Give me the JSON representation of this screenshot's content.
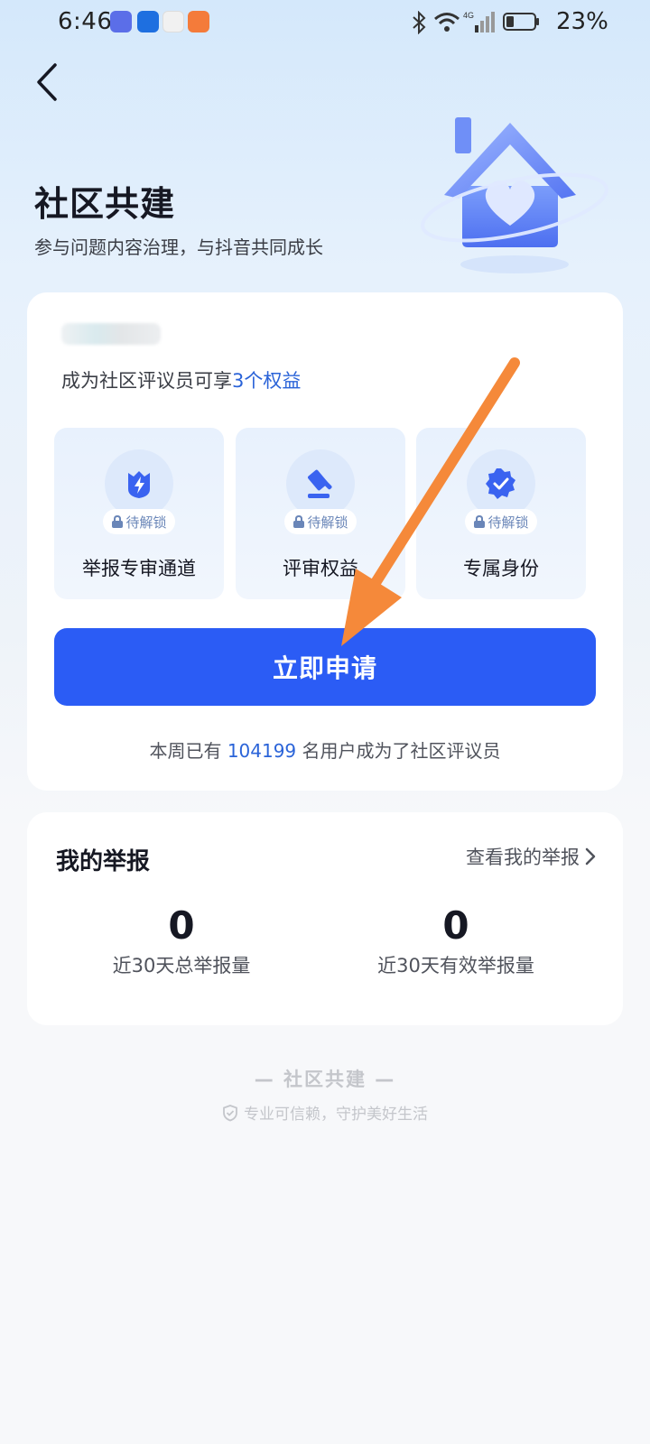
{
  "status_bar": {
    "time": "6:46",
    "battery": "23%"
  },
  "header": {
    "back_icon": "back-arrow-icon"
  },
  "page": {
    "title": "社区共建",
    "subtitle": "参与问题内容治理，与抖音共同成长"
  },
  "benefits_card": {
    "intro_prefix": "成为社区评议员可享",
    "intro_highlight": "3个权益",
    "items": [
      {
        "icon": "lightning-shield-icon",
        "badge": "待解锁",
        "label": "举报专审通道"
      },
      {
        "icon": "gavel-icon",
        "badge": "待解锁",
        "label": "评审权益"
      },
      {
        "icon": "verified-badge-icon",
        "badge": "待解锁",
        "label": "专属身份"
      }
    ],
    "apply_label": "立即申请",
    "weekly_prefix": "本周已有",
    "weekly_count": "104199",
    "weekly_suffix": "名用户成为了社区评议员"
  },
  "report_card": {
    "title": "我的举报",
    "link": "查看我的举报",
    "stats": [
      {
        "value": "0",
        "label": "近30天总举报量"
      },
      {
        "value": "0",
        "label": "近30天有效举报量"
      }
    ]
  },
  "footer": {
    "brand": "— 社区共建 —",
    "slogan": "专业可信赖，守护美好生活"
  },
  "colors": {
    "primary": "#2b5cf5",
    "highlight": "#2a63d8",
    "annotation_arrow": "#f5893a"
  }
}
